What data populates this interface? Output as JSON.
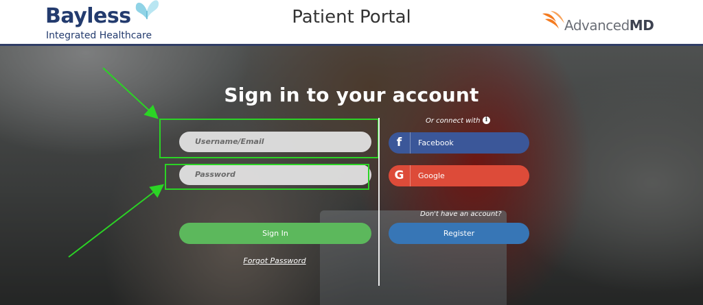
{
  "header": {
    "brand_name": "Bayless",
    "brand_subtitle": "Integrated Healthcare",
    "portal_title": "Patient Portal",
    "partner_name_light": "Advanced",
    "partner_name_bold": "MD"
  },
  "signin": {
    "title": "Sign in to your account",
    "username_placeholder": "Username/Email",
    "password_placeholder": "Password",
    "signin_label": "Sign In",
    "forgot_label": "Forgot Password"
  },
  "social": {
    "connect_hint": "Or connect with",
    "facebook_label": "Facebook",
    "google_label": "Google",
    "facebook_glyph": "f",
    "google_glyph": "G"
  },
  "register": {
    "hint": "Don't have an account?",
    "label": "Register"
  },
  "colors": {
    "brand_navy": "#233b6e",
    "signin_green": "#5cb85c",
    "facebook_blue": "#3b5799",
    "google_red": "#dd4b39",
    "register_blue": "#3776b6",
    "highlight_green": "#2bd425",
    "partner_orange": "#f47b20"
  },
  "icons": {
    "brand": "butterfly-icon",
    "partner": "advancedmd-bird-icon",
    "info": "info-icon",
    "facebook": "facebook-icon",
    "google": "google-icon"
  }
}
